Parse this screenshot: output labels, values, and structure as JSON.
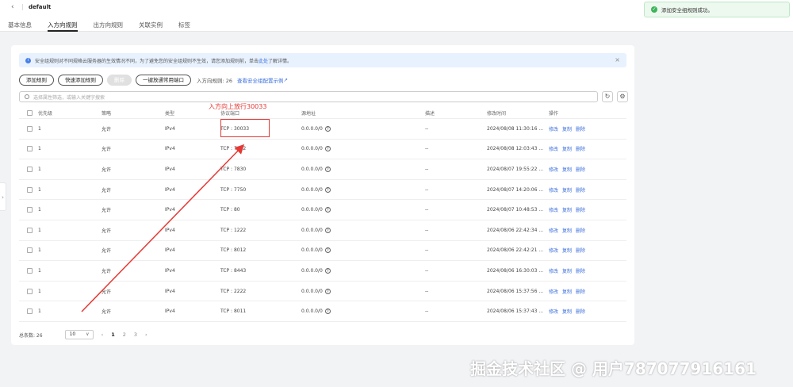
{
  "header": {
    "title": "default",
    "tabs": [
      "基本信息",
      "入方向规则",
      "出方向规则",
      "关联实例",
      "标签"
    ]
  },
  "toast": {
    "text": "添加安全组规则成功。"
  },
  "notice": {
    "text": "安全组规则对不同规格云服务器的生效情况不同，为了避免您的安全组规则不生效，请您添加规则前，单击此处",
    "link": "此处",
    "suffix": "了解详情。"
  },
  "toolbar": {
    "add_rule": "添加规则",
    "quick_add": "快速添加规则",
    "delete": "删除",
    "open_common": "一键放通常用端口",
    "rule_count": "入方向规则: 26",
    "example_link": "查看安全组配置示例"
  },
  "search": {
    "placeholder": "选择属性筛选，或输入关键字搜索"
  },
  "table": {
    "headers": [
      "优先级",
      "策略",
      "类型",
      "协议端口",
      "源地址",
      "描述",
      "修改时间",
      "操作"
    ],
    "rows": [
      [
        "1",
        "允许",
        "IPv4",
        "TCP : 30033",
        "0.0.0.0/0",
        "--",
        "2024/08/08 11:30:16 ..."
      ],
      [
        "1",
        "允许",
        "IPv4",
        "TCP : 7842",
        "0.0.0.0/0",
        "--",
        "2024/08/08 12:03:43 ..."
      ],
      [
        "1",
        "允许",
        "IPv4",
        "TCP : 7830",
        "0.0.0.0/0",
        "--",
        "2024/08/07 19:55:22 ..."
      ],
      [
        "1",
        "允许",
        "IPv4",
        "TCP : 7750",
        "0.0.0.0/0",
        "--",
        "2024/08/07 14:20:06 ..."
      ],
      [
        "1",
        "允许",
        "IPv4",
        "TCP : 80",
        "0.0.0.0/0",
        "--",
        "2024/08/07 10:48:53 ..."
      ],
      [
        "1",
        "允许",
        "IPv4",
        "TCP : 1222",
        "0.0.0.0/0",
        "--",
        "2024/08/06 22:42:34 ..."
      ],
      [
        "1",
        "允许",
        "IPv4",
        "TCP : 8012",
        "0.0.0.0/0",
        "--",
        "2024/08/06 22:42:21 ..."
      ],
      [
        "1",
        "允许",
        "IPv4",
        "TCP : 8443",
        "0.0.0.0/0",
        "--",
        "2024/08/06 16:30:03 ..."
      ],
      [
        "1",
        "允许",
        "IPv4",
        "TCP : 2222",
        "0.0.0.0/0",
        "--",
        "2024/08/06 15:37:56 ..."
      ],
      [
        "1",
        "允许",
        "IPv4",
        "TCP : 8011",
        "0.0.0.0/0",
        "--",
        "2024/08/06 15:37:43 ..."
      ]
    ],
    "ops": [
      "修改",
      "复制",
      "删除"
    ]
  },
  "pager": {
    "total": "总条数: 26",
    "page_size": "10",
    "pages": [
      "1",
      "2",
      "3"
    ]
  },
  "annotation": {
    "text": "入方向上放行30033"
  },
  "watermark": {
    "text": "掘金技术社区 @ 用户787077916161"
  },
  "colors": {
    "link": "#3b6fdc",
    "annotation": "#e53935",
    "success": "#3db45a",
    "notice_bg": "#e8f2ff"
  }
}
